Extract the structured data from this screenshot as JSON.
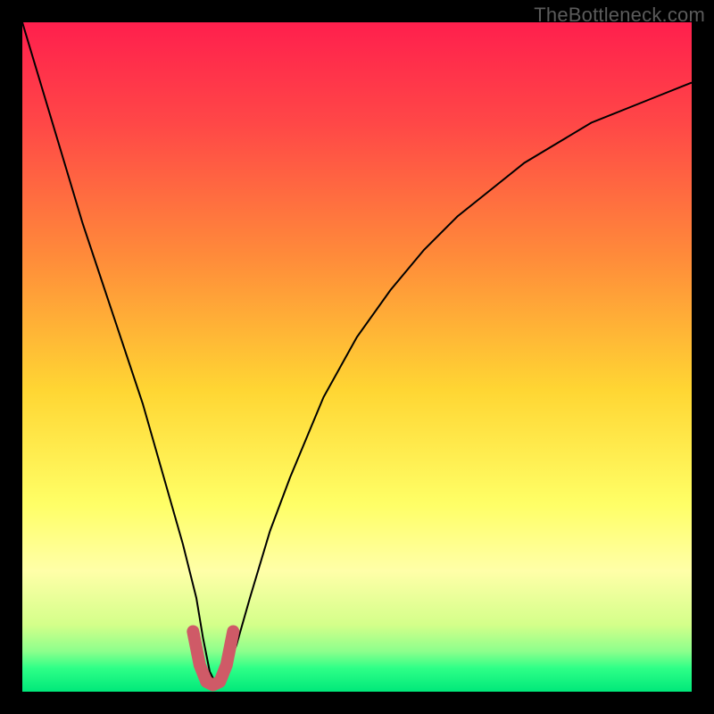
{
  "watermark": "TheBottleneck.com",
  "chart_data": {
    "type": "line",
    "title": "",
    "xlabel": "",
    "ylabel": "",
    "xlim": [
      0,
      100
    ],
    "ylim": [
      0,
      100
    ],
    "series": [
      {
        "name": "bottleneck-curve",
        "x": [
          0,
          3,
          6,
          9,
          12,
          15,
          18,
          20,
          22,
          24,
          26,
          27,
          28,
          29,
          30,
          32,
          34,
          37,
          40,
          45,
          50,
          55,
          60,
          65,
          70,
          75,
          80,
          85,
          90,
          95,
          100
        ],
        "y": [
          100,
          90,
          80,
          70,
          61,
          52,
          43,
          36,
          29,
          22,
          14,
          8,
          3,
          1,
          2,
          7,
          14,
          24,
          32,
          44,
          53,
          60,
          66,
          71,
          75,
          79,
          82,
          85,
          87,
          89,
          91
        ],
        "stroke": "#000000",
        "stroke_width": 2
      },
      {
        "name": "optimal-marker",
        "x": [
          25.5,
          26.5,
          27.5,
          28.5,
          29.5,
          30.5,
          31.5
        ],
        "y": [
          9,
          4,
          1.5,
          1,
          1.5,
          4,
          9
        ],
        "stroke": "#cf5a67",
        "stroke_width": 14
      }
    ],
    "background_gradient_stops": [
      {
        "offset": 0.0,
        "color": "#ff1f4d"
      },
      {
        "offset": 0.15,
        "color": "#ff4747"
      },
      {
        "offset": 0.35,
        "color": "#ff8b3a"
      },
      {
        "offset": 0.55,
        "color": "#ffd633"
      },
      {
        "offset": 0.72,
        "color": "#ffff66"
      },
      {
        "offset": 0.82,
        "color": "#ffffa8"
      },
      {
        "offset": 0.9,
        "color": "#d4ff8a"
      },
      {
        "offset": 0.94,
        "color": "#8cff8c"
      },
      {
        "offset": 0.965,
        "color": "#2eff87"
      },
      {
        "offset": 1.0,
        "color": "#00e87a"
      }
    ]
  }
}
